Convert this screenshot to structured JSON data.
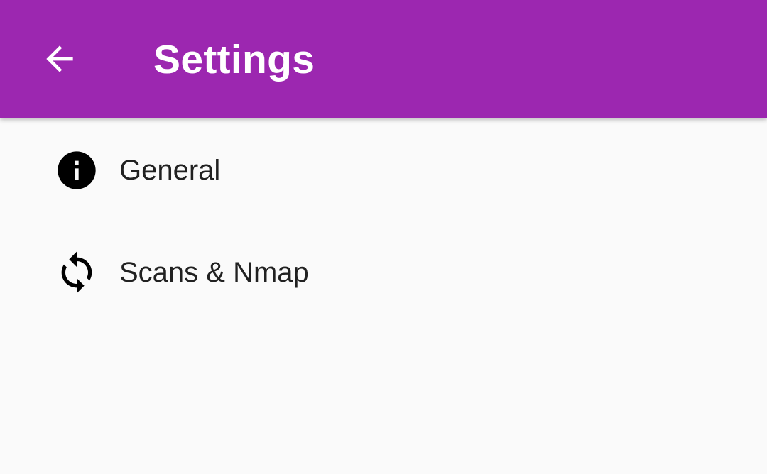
{
  "app_bar": {
    "title": "Settings",
    "back_icon": "arrow-back-icon",
    "color": "#9c27b0"
  },
  "preferences": [
    {
      "label": "General",
      "icon": "info-icon"
    },
    {
      "label": "Scans & Nmap",
      "icon": "sync-icon"
    }
  ]
}
